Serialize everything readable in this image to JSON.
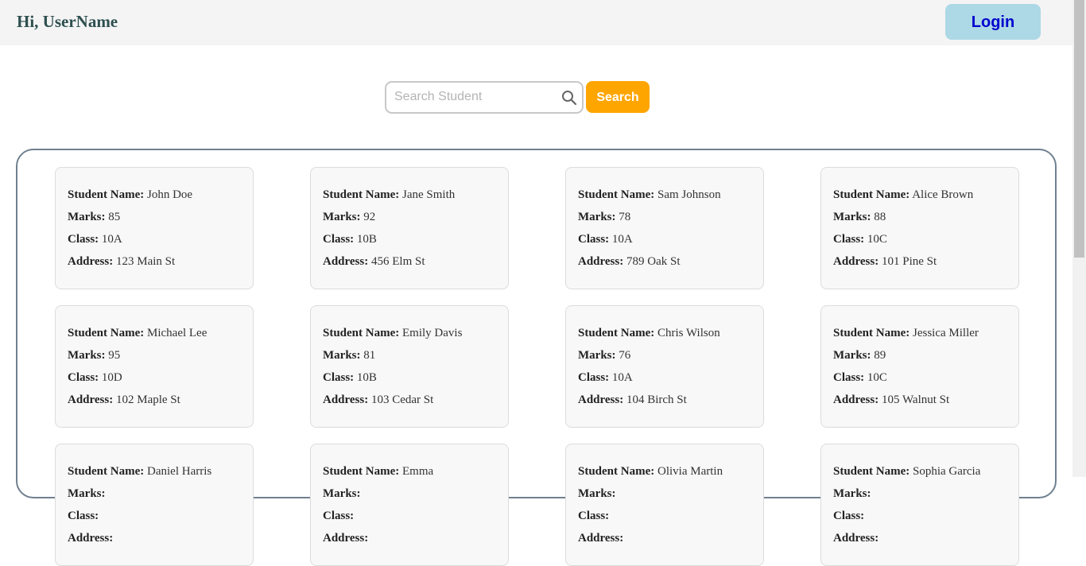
{
  "header": {
    "greeting": "Hi, UserName",
    "login_label": "Login"
  },
  "search": {
    "placeholder": "Search Student",
    "button_label": "Search"
  },
  "labels": {
    "name": "Student Name:",
    "marks": "Marks:",
    "class": "Class:",
    "address": "Address:"
  },
  "students": [
    {
      "name": "John Doe",
      "marks": "85",
      "class": "10A",
      "address": "123 Main St"
    },
    {
      "name": "Jane Smith",
      "marks": "92",
      "class": "10B",
      "address": "456 Elm St"
    },
    {
      "name": "Sam Johnson",
      "marks": "78",
      "class": "10A",
      "address": "789 Oak St"
    },
    {
      "name": "Alice Brown",
      "marks": "88",
      "class": "10C",
      "address": "101 Pine St"
    },
    {
      "name": "Michael Lee",
      "marks": "95",
      "class": "10D",
      "address": "102 Maple St"
    },
    {
      "name": "Emily Davis",
      "marks": "81",
      "class": "10B",
      "address": "103 Cedar St"
    },
    {
      "name": "Chris Wilson",
      "marks": "76",
      "class": "10A",
      "address": "104 Birch St"
    },
    {
      "name": "Jessica Miller",
      "marks": "89",
      "class": "10C",
      "address": "105 Walnut St"
    },
    {
      "name": "Daniel Harris",
      "marks": "",
      "class": "",
      "address": ""
    },
    {
      "name": "Emma",
      "marks": "",
      "class": "",
      "address": ""
    },
    {
      "name": "Olivia Martin",
      "marks": "",
      "class": "",
      "address": ""
    },
    {
      "name": "Sophia Garcia",
      "marks": "",
      "class": "",
      "address": ""
    }
  ],
  "colors": {
    "login_bg": "#add8e6",
    "search_button_bg": "#ffa500",
    "container_border": "#708090"
  }
}
